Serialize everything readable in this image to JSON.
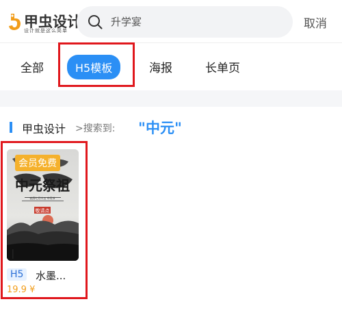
{
  "header": {
    "logo_text": "甲虫设计",
    "logo_slogan": "设计就是这么简单",
    "search_placeholder": "升学宴",
    "cancel_label": "取消"
  },
  "tabs": [
    {
      "label": "全部"
    },
    {
      "label": "H5模板",
      "selected": true
    },
    {
      "label": "海报"
    },
    {
      "label": "长单页"
    }
  ],
  "breadcrumb": {
    "site": "甲虫设计",
    "separator": ">搜索到:",
    "keyword": "\"中元\""
  },
  "results": [
    {
      "badge": "会员免费",
      "tag": "H5",
      "title": "水墨...",
      "price": "19.9 ¥",
      "poster_title": "中元祭祖",
      "poster_subtitle": "敬请点",
      "poster_line": "农历七月十五 中元节"
    }
  ],
  "colors": {
    "accent": "#2b8ff5",
    "highlight": "#e0171c",
    "badge": "#f5b12c",
    "price": "#f29d1a"
  },
  "icons": {
    "search": "search-icon",
    "logo": "beetle-logo-icon"
  }
}
